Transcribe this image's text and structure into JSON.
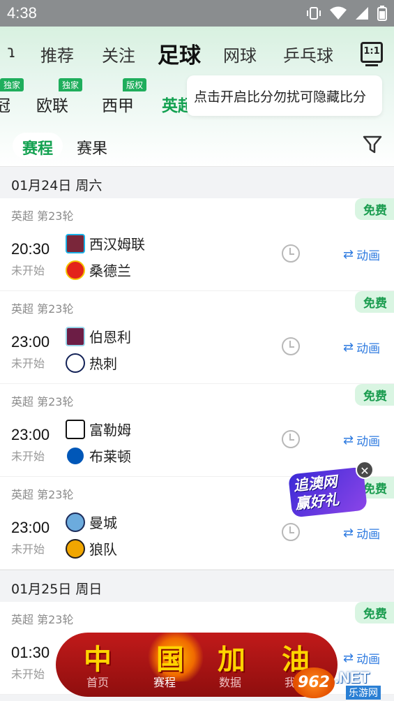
{
  "status": {
    "time": "4:38"
  },
  "topnav": {
    "partial": "ɿ",
    "tabs": [
      "推荐",
      "关注",
      "足球",
      "网球",
      "乒乓球"
    ],
    "active": "足球",
    "tv_label": "1:1"
  },
  "leagues": {
    "partial": "冠",
    "items": [
      "欧联",
      "西甲",
      "英超"
    ],
    "badges": [
      "独家",
      "独家",
      "版权"
    ]
  },
  "tooltip": "点击开启比分勿扰可隐藏比分",
  "subtabs": {
    "schedule": "赛程",
    "results": "赛果"
  },
  "dates": [
    "01月24日 周六",
    "01月25日 周日"
  ],
  "matches": [
    {
      "comp": "英超 第23轮",
      "time": "20:30",
      "state": "未开始",
      "home": "西汉姆联",
      "away": "桑德兰",
      "free": "免费",
      "anim": "动画",
      "home_color": "#7a263a",
      "away_color": "#e3251b"
    },
    {
      "comp": "英超 第23轮",
      "time": "23:00",
      "state": "未开始",
      "home": "伯恩利",
      "away": "热刺",
      "free": "免费",
      "anim": "动画",
      "home_color": "#6c1d45",
      "away_color": "#132257"
    },
    {
      "comp": "英超 第23轮",
      "time": "23:00",
      "state": "未开始",
      "home": "富勒姆",
      "away": "布莱顿",
      "free": "免费",
      "anim": "动画",
      "home_color": "#111111",
      "away_color": "#0057b8"
    },
    {
      "comp": "英超 第23轮",
      "time": "23:00",
      "state": "未开始",
      "home": "曼城",
      "away": "狼队",
      "free": "免费",
      "anim": "动画",
      "home_color": "#6cabdd",
      "away_color": "#f1a600"
    },
    {
      "comp": "英超 第23轮",
      "time": "01:30",
      "state": "未开始",
      "free": "免费",
      "anim": "动画"
    }
  ],
  "ad": {
    "line1": "追澳网",
    "line2": "赢好礼",
    "close": "✕"
  },
  "bottombar": {
    "chars": [
      "中",
      "国",
      "加",
      "油"
    ],
    "labels": [
      "首页",
      "赛程",
      "数据",
      "我的"
    ],
    "active": "赛程"
  },
  "watermark": {
    "logo": "962",
    "site": ".NET",
    "sub": "乐游网"
  }
}
